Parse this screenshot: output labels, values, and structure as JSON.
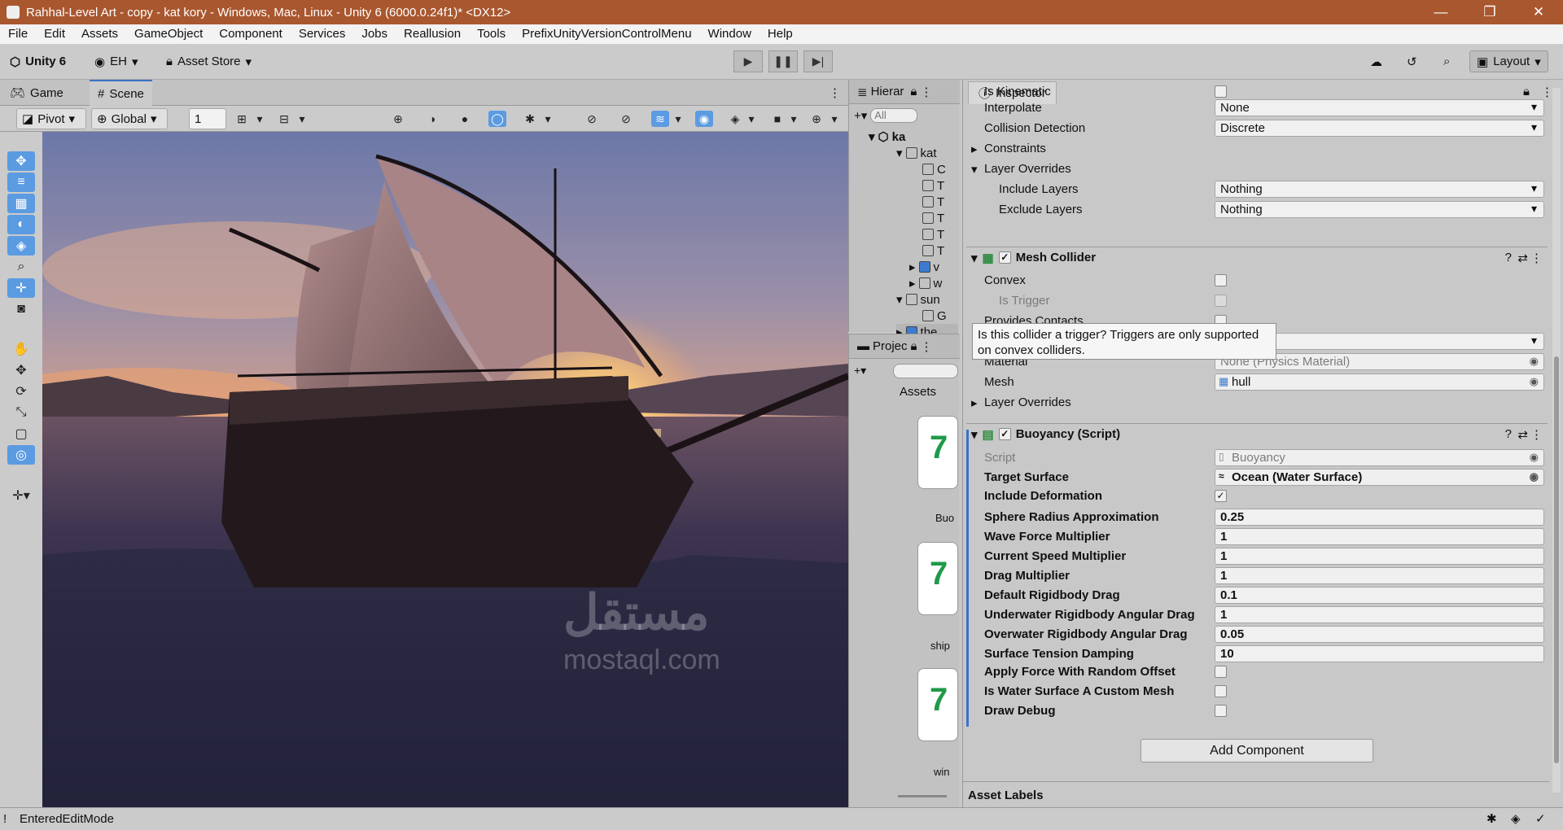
{
  "window": {
    "title": "Rahhal-Level Art - copy - kat kory - Windows, Mac, Linux - Unity 6 (6000.0.24f1)* <DX12>"
  },
  "menu": [
    "File",
    "Edit",
    "Assets",
    "GameObject",
    "Component",
    "Services",
    "Jobs",
    "Reallusion",
    "Tools",
    "PrefixUnityVersionControlMenu",
    "Window",
    "Help"
  ],
  "toolbar": {
    "unity_label": "Unity 6",
    "account": "EH",
    "asset_store": "Asset Store",
    "layout": "Layout"
  },
  "scene_tabs": {
    "game": "Game",
    "scene": "Scene"
  },
  "scene_toolbar": {
    "pivot": "Pivot",
    "global": "Global",
    "grid_value": "1"
  },
  "hierarchy": {
    "tab_label": "Hierar",
    "search_placeholder": "All",
    "items": [
      "ka",
      "kat",
      "C",
      "T",
      "T",
      "T",
      "T",
      "T",
      "v",
      "w",
      "sun",
      "G",
      "the"
    ]
  },
  "project": {
    "tab_label": "Projec",
    "assets_label": "Assets",
    "asset_names": [
      "Buo",
      "ship",
      "win"
    ]
  },
  "inspector": {
    "tab_label": "Inspector",
    "rigidbody": {
      "is_kinematic_label": "Is Kinematic",
      "interpolate_label": "Interpolate",
      "interpolate_value": "None",
      "collision_label": "Collision Detection",
      "collision_value": "Discrete",
      "constraints_label": "Constraints",
      "layer_overrides_label": "Layer Overrides",
      "include_layers_label": "Include Layers",
      "include_layers_value": "Nothing",
      "exclude_layers_label": "Exclude Layers",
      "exclude_layers_value": "Nothing"
    },
    "mesh_collider": {
      "title": "Mesh Collider",
      "convex_label": "Convex",
      "is_trigger_label": "Is Trigger",
      "provides_contacts_label": "Provides Contacts",
      "cooking_value": "d",
      "material_label": "Material",
      "material_value": "None (Physics Material)",
      "mesh_label": "Mesh",
      "mesh_value": "hull",
      "layer_overrides_label": "Layer Overrides"
    },
    "tooltip": "Is this collider a trigger? Triggers are only supported on convex colliders.",
    "buoyancy": {
      "title": "Buoyancy (Script)",
      "script_label": "Script",
      "script_value": "Buoyancy",
      "target_label": "Target Surface",
      "target_value": "Ocean (Water Surface)",
      "include_deformation_label": "Include Deformation",
      "fields": [
        {
          "label": "Sphere Radius Approximation",
          "value": "0.25"
        },
        {
          "label": "Wave Force Multiplier",
          "value": "1"
        },
        {
          "label": "Current Speed Multiplier",
          "value": "1"
        },
        {
          "label": "Drag Multiplier",
          "value": "1"
        },
        {
          "label": "Default Rigidbody Drag",
          "value": "0.1"
        },
        {
          "label": "Underwater Rigidbody Angular Drag",
          "value": "1"
        },
        {
          "label": "Overwater Rigidbody Angular Drag",
          "value": "0.05"
        },
        {
          "label": "Surface Tension Damping",
          "value": "10"
        }
      ],
      "apply_force_label": "Apply Force With Random Offset",
      "custom_mesh_label": "Is Water Surface A Custom Mesh",
      "draw_debug_label": "Draw Debug"
    },
    "add_component": "Add Component",
    "asset_labels": "Asset Labels"
  },
  "watermark": {
    "arabic": "مستقل",
    "latin": "mostaql.com"
  },
  "status": {
    "text": "EnteredEditMode"
  }
}
